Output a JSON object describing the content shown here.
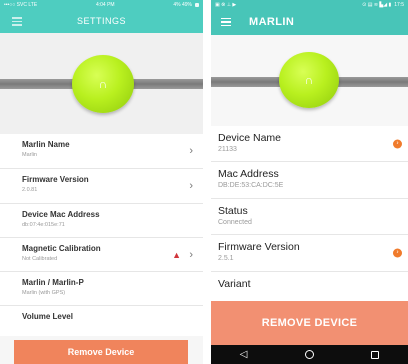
{
  "colors": {
    "teal": "#4ecdc0",
    "accent_orange": "#f0845c",
    "warning_red": "#d0353b"
  },
  "left": {
    "status": {
      "carrier": "•••○○ SVC LTE",
      "time": "4:04 PM",
      "battery": "4% 49%"
    },
    "header": {
      "title": "SETTINGS",
      "menu_icon": "hamburger-icon"
    },
    "items": [
      {
        "label": "Marlin Name",
        "value": "Marlin",
        "chevron": true
      },
      {
        "label": "Firmware Version",
        "value": "2.0.81",
        "chevron": true
      },
      {
        "label": "Device Mac Address",
        "value": "db:07:4e:015e:71",
        "chevron": false
      },
      {
        "label": "Magnetic Calibration",
        "value": "Not Calibrated",
        "chevron": true,
        "warning": true
      },
      {
        "label": "Marlin / Marlin-P",
        "value": "Marlin (with GPS)",
        "chevron": false
      },
      {
        "label": "Volume Level",
        "value": "",
        "chevron": false
      }
    ],
    "remove_label": "Remove Device"
  },
  "right": {
    "status": {
      "left_icons": "▣ ⊗ ⊥ ▶",
      "right_icons": "⊙ ▤ ≋ ▙◢ ▮",
      "time": "17:5"
    },
    "header": {
      "title": "MARLIN",
      "menu_icon": "hamburger-icon"
    },
    "items": [
      {
        "label": "Device Name",
        "value": "21133",
        "arrow": true
      },
      {
        "label": "Mac Address",
        "value": "DB:DE:53:CA:DC:5E",
        "arrow": false
      },
      {
        "label": "Status",
        "value": "Connected",
        "arrow": false
      },
      {
        "label": "Firmware Version",
        "value": "2.5.1",
        "arrow": true
      },
      {
        "label": "Variant",
        "value": "",
        "arrow": false
      }
    ],
    "remove_label": "REMOVE DEVICE",
    "nav": {
      "back": "◁",
      "home": "",
      "recents": ""
    }
  }
}
